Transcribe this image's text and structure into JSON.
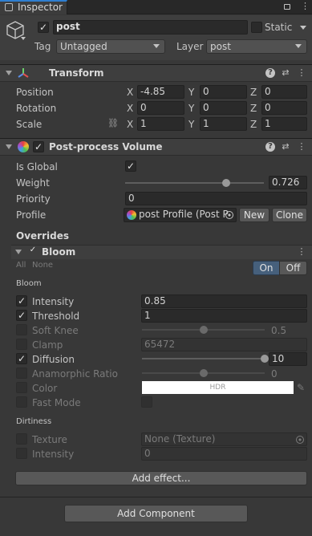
{
  "tab": {
    "title": "Inspector"
  },
  "gameobject": {
    "name": "post",
    "static_label": "Static",
    "tag_label": "Tag",
    "tag_value": "Untagged",
    "layer_label": "Layer",
    "layer_value": "post"
  },
  "transform": {
    "title": "Transform",
    "position": {
      "label": "Position",
      "x": "-4.85",
      "y": "0",
      "z": "0"
    },
    "rotation": {
      "label": "Rotation",
      "x": "0",
      "y": "0",
      "z": "0"
    },
    "scale": {
      "label": "Scale",
      "x": "1",
      "y": "1",
      "z": "1"
    },
    "axis_x": "X",
    "axis_y": "Y",
    "axis_z": "Z"
  },
  "volume": {
    "title": "Post-process Volume",
    "is_global_label": "Is Global",
    "weight_label": "Weight",
    "weight_value": "0.726",
    "weight_fraction": 0.726,
    "priority_label": "Priority",
    "priority_value": "0",
    "profile_label": "Profile",
    "profile_value": "post Profile (Post P",
    "new_label": "New",
    "clone_label": "Clone",
    "overrides_label": "Overrides"
  },
  "bloom": {
    "title": "Bloom",
    "all_label": "All",
    "none_label": "None",
    "on_label": "On",
    "off_label": "Off",
    "section_label": "Bloom",
    "intensity_label": "Intensity",
    "intensity_value": "0.85",
    "threshold_label": "Threshold",
    "threshold_value": "1",
    "soft_knee_label": "Soft Knee",
    "soft_knee_value": "0.5",
    "soft_knee_fraction": 0.5,
    "clamp_label": "Clamp",
    "clamp_value": "65472",
    "diffusion_label": "Diffusion",
    "diffusion_value": "10",
    "diffusion_fraction": 1.0,
    "anamorphic_label": "Anamorphic Ratio",
    "anamorphic_value": "0",
    "anamorphic_fraction": 0.5,
    "color_label": "Color",
    "color_value": "HDR",
    "color_hex": "#ffffff",
    "fast_mode_label": "Fast Mode",
    "dirtiness_label": "Dirtiness",
    "texture_label": "Texture",
    "texture_value": "None (Texture)",
    "dirt_intensity_label": "Intensity",
    "dirt_intensity_value": "0"
  },
  "add_effect_label": "Add effect...",
  "add_component_label": "Add Component",
  "colors": {
    "on_active": "#46607c",
    "background": "#383838"
  }
}
